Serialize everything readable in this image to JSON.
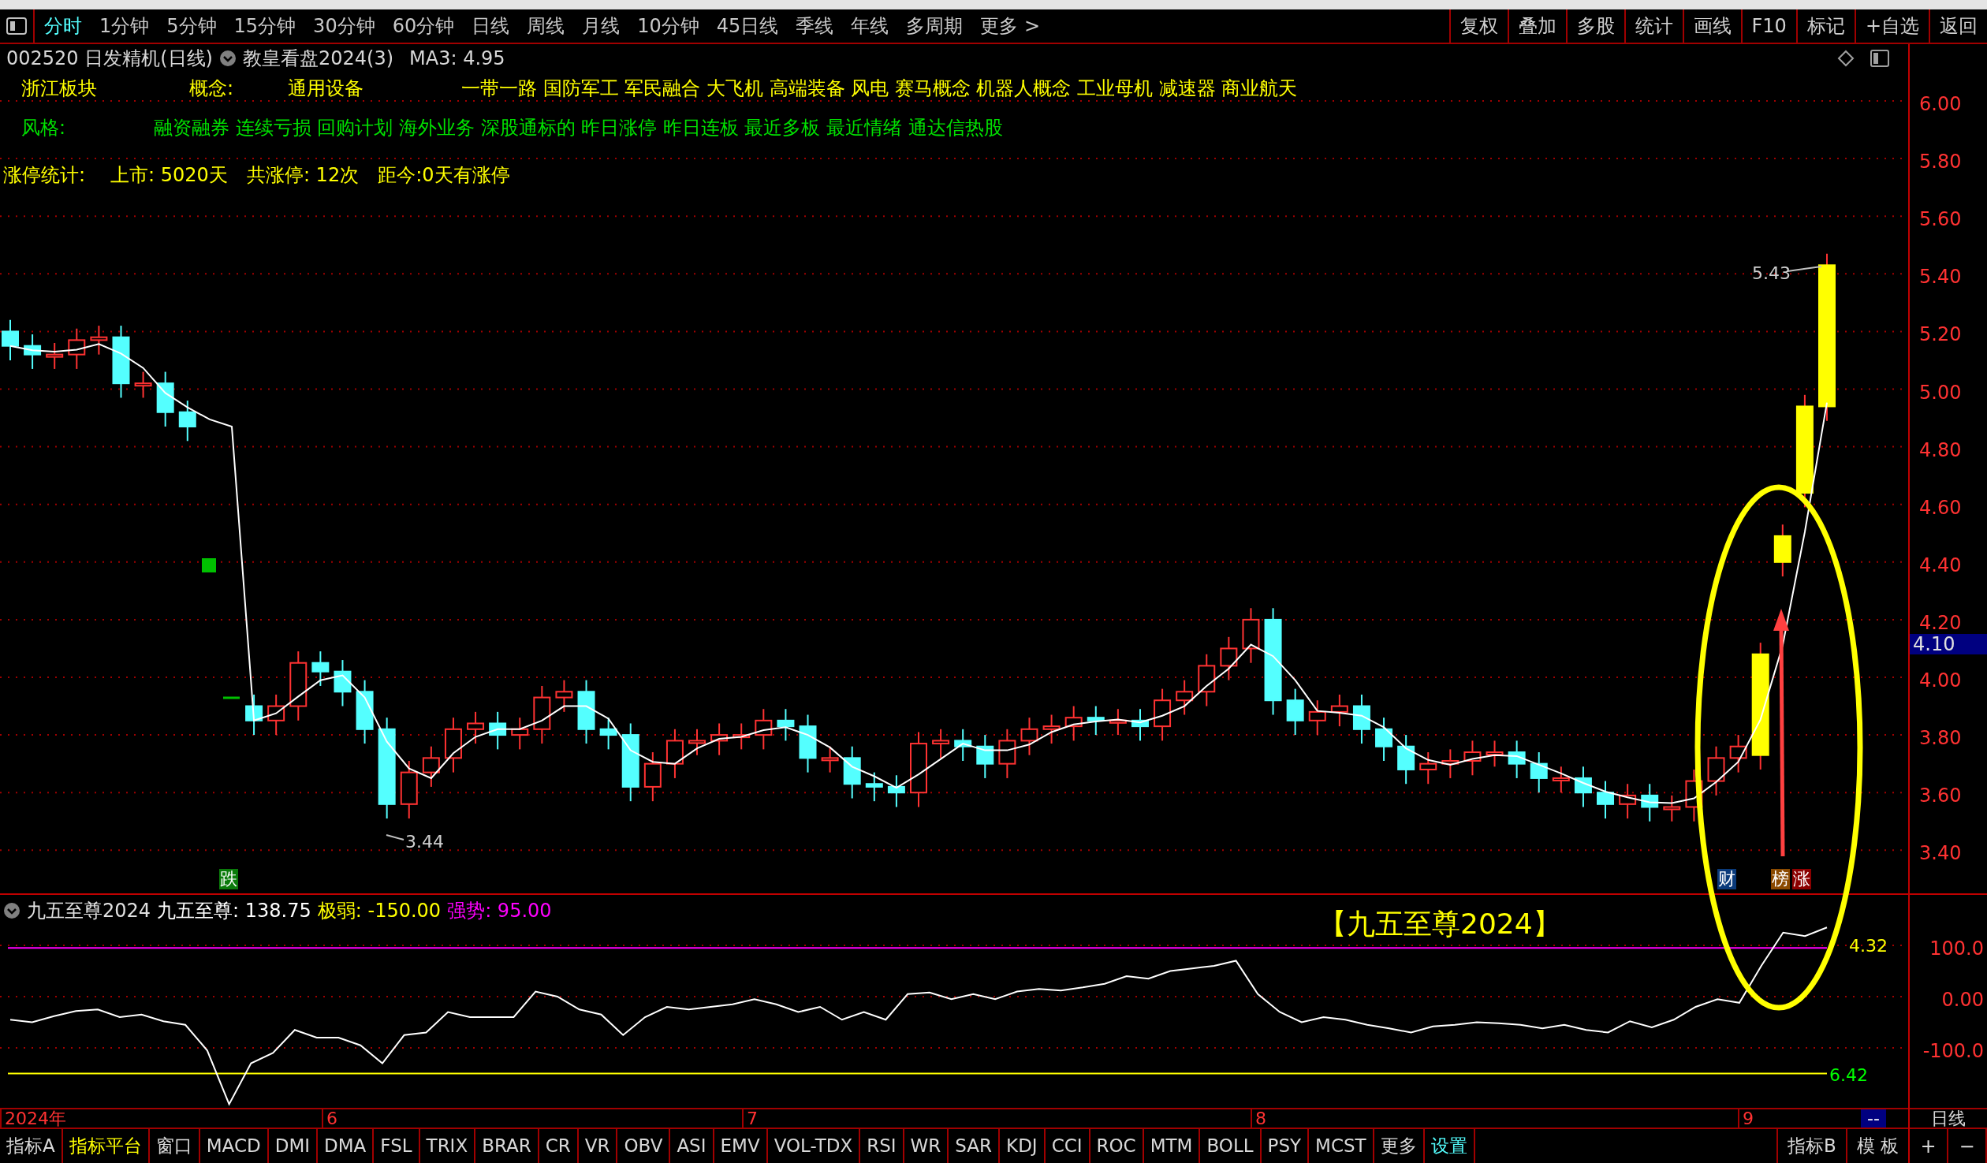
{
  "toolbar": {
    "periods": [
      {
        "label": "分时",
        "selected": true
      },
      {
        "label": "1分钟",
        "selected": false
      },
      {
        "label": "5分钟",
        "selected": false
      },
      {
        "label": "15分钟",
        "selected": false
      },
      {
        "label": "30分钟",
        "selected": false
      },
      {
        "label": "60分钟",
        "selected": false
      },
      {
        "label": "日线",
        "selected": false
      },
      {
        "label": "周线",
        "selected": false
      },
      {
        "label": "月线",
        "selected": false
      },
      {
        "label": "10分钟",
        "selected": false
      },
      {
        "label": "45日线",
        "selected": false
      },
      {
        "label": "季线",
        "selected": false
      },
      {
        "label": "年线",
        "selected": false
      },
      {
        "label": "多周期",
        "selected": false
      },
      {
        "label": "更多 >",
        "selected": false
      }
    ],
    "buttons": [
      "复权",
      "叠加",
      "多股",
      "统计",
      "画线",
      "F10",
      "标记",
      "+自选",
      "返回"
    ]
  },
  "stock_header": {
    "title": "002520 日发精机(日线)",
    "formula": "教皇看盘2024(3)",
    "ma": "MA3: 4.95"
  },
  "sector": {
    "region": "浙江板块",
    "concept_label": "概念:",
    "industry": "通用设备",
    "concepts": "一带一路 国防军工 军民融合 大飞机 高端装备 风电 赛马概念 机器人概念 工业母机 减速器 商业航天"
  },
  "style": {
    "label": "风格:",
    "tags": "融资融券 连续亏损 回购计划 海外业务 深股通标的 昨日涨停 昨日连板 最近多板 最近情绪 通达信热股"
  },
  "limit_stats": [
    "涨停统计:",
    "上市: 5020天",
    "共涨停: 12次",
    "距今:0天有涨停"
  ],
  "price_axis": [
    "6.00",
    "5.80",
    "5.60",
    "5.40",
    "5.20",
    "5.00",
    "4.80",
    "4.60",
    "4.40",
    "4.20",
    "4.00",
    "3.80",
    "3.60",
    "3.40"
  ],
  "current_price": "4.10",
  "chart_labels": {
    "high": "5.43",
    "low": "3.44"
  },
  "signals": [
    {
      "label": "跌",
      "color": "#0a7a0a"
    },
    {
      "label": "财",
      "color": "#0a3a7a"
    },
    {
      "label": "榜",
      "color": "#8b4a00"
    },
    {
      "label": "涨",
      "color": "#8b0000"
    }
  ],
  "annotation": "【九五至尊2024】",
  "indicator": {
    "name": "九五至尊2024",
    "values": [
      {
        "label": "九五至尊:",
        "value": "138.75",
        "color": "#ffffff"
      },
      {
        "label": "极弱:",
        "value": "-150.00",
        "color": "#ffff00"
      },
      {
        "label": "强势:",
        "value": "95.00",
        "color": "#ff00ff"
      }
    ],
    "axis": [
      "100.0",
      "0.00",
      "-100.0"
    ],
    "line_labels": [
      "4.32",
      "6.42"
    ]
  },
  "date_axis": {
    "labels": [
      "2024年",
      "6",
      "7",
      "8",
      "9"
    ],
    "marker": "--",
    "period": "日线"
  },
  "bottom_tabs": [
    {
      "label": "指标A",
      "selected": false
    },
    {
      "label": "指标平台",
      "selected": true
    },
    {
      "label": "窗口",
      "selected": false
    },
    {
      "label": "MACD",
      "selected": false
    },
    {
      "label": "DMI",
      "selected": false
    },
    {
      "label": "DMA",
      "selected": false
    },
    {
      "label": "FSL",
      "selected": false
    },
    {
      "label": "TRIX",
      "selected": false
    },
    {
      "label": "BRAR",
      "selected": false
    },
    {
      "label": "CR",
      "selected": false
    },
    {
      "label": "VR",
      "selected": false
    },
    {
      "label": "OBV",
      "selected": false
    },
    {
      "label": "ASI",
      "selected": false
    },
    {
      "label": "EMV",
      "selected": false
    },
    {
      "label": "VOL-TDX",
      "selected": false
    },
    {
      "label": "RSI",
      "selected": false
    },
    {
      "label": "WR",
      "selected": false
    },
    {
      "label": "SAR",
      "selected": false
    },
    {
      "label": "KDJ",
      "selected": false
    },
    {
      "label": "CCI",
      "selected": false
    },
    {
      "label": "ROC",
      "selected": false
    },
    {
      "label": "MTM",
      "selected": false
    },
    {
      "label": "BOLL",
      "selected": false
    },
    {
      "label": "PSY",
      "selected": false
    },
    {
      "label": "MCST",
      "selected": false
    },
    {
      "label": "更多",
      "selected": false
    },
    {
      "label": "设置",
      "selected": false,
      "kind": "settings"
    }
  ],
  "bottom_right": [
    "指标B",
    "模 板",
    "+",
    "−"
  ]
}
